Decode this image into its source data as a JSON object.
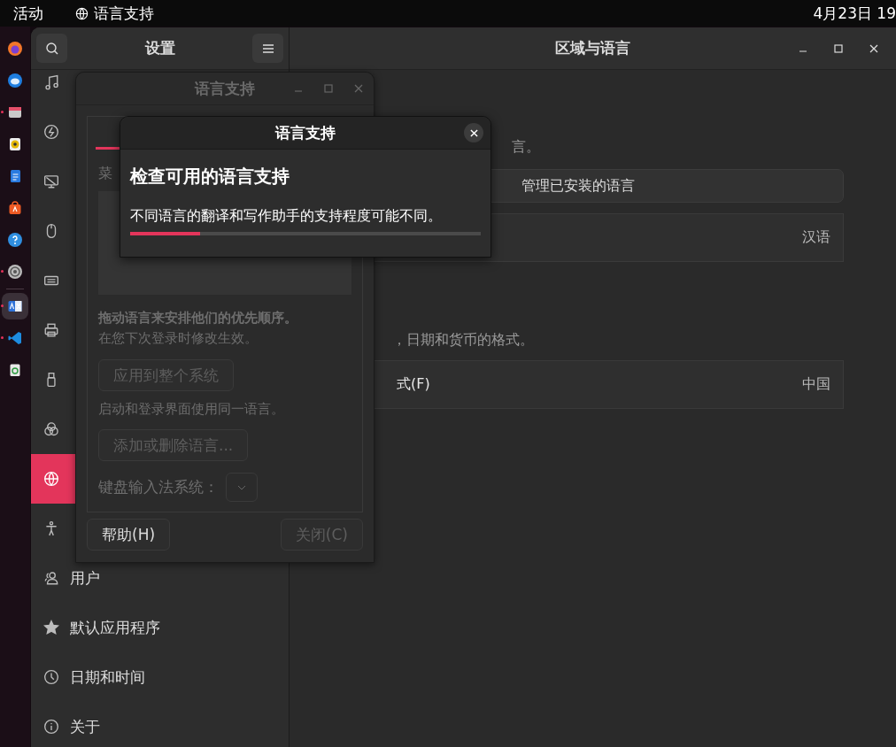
{
  "top_bar": {
    "activities": "活动",
    "app_menu": "语言支持",
    "clock": "4月23日 19"
  },
  "dock": [
    {
      "running": false,
      "selected": false
    },
    {
      "running": false,
      "selected": false
    },
    {
      "running": true,
      "selected": false
    },
    {
      "running": false,
      "selected": false
    },
    {
      "running": false,
      "selected": false
    },
    {
      "running": false,
      "selected": false
    },
    {
      "running": false,
      "selected": false
    },
    {
      "running": true,
      "selected": false
    },
    {
      "running": true,
      "selected": true
    },
    {
      "running": true,
      "selected": false
    },
    {
      "running": false,
      "selected": false
    }
  ],
  "settings_window": {
    "sidebar_title": "设置",
    "title": "区域与语言",
    "sidebar": [
      {
        "selected": false
      },
      {
        "selected": false
      },
      {
        "selected": false
      },
      {
        "selected": false
      },
      {
        "selected": false
      },
      {
        "selected": false
      },
      {
        "selected": false
      },
      {
        "selected": false
      },
      {
        "selected": true
      },
      {
        "selected": false
      },
      {
        "label": "用户",
        "selected": false
      },
      {
        "label": "默认应用程序",
        "selected": false
      },
      {
        "label": "日期和时间",
        "selected": false
      },
      {
        "label": "关于",
        "selected": false
      }
    ],
    "content": {
      "language_note": "言。",
      "manage_button": "管理已安装的语言",
      "language_value": "汉语",
      "formats_note": "，日期和货币的格式。",
      "formats_label": "式(F)",
      "formats_value": "中国"
    }
  },
  "language_window": {
    "title": "语言支持",
    "tabs": [
      {
        "selected": true
      }
    ],
    "list_label": "菜",
    "order_hint": "拖动语言来安排他们的优先顺序。",
    "login_hint": "在您下次登录时修改生效。",
    "apply_button": {
      "label": "应用到整个系统",
      "disabled": true
    },
    "system_hint": "启动和登录界面使用同一语言。",
    "add_button": {
      "label": "添加或删除语言...",
      "disabled": true
    },
    "input_label": "键盘输入法系统：",
    "help_button": {
      "label": "帮助(H)",
      "disabled": false
    },
    "close_button": {
      "label": "关闭(C)",
      "disabled": true
    }
  },
  "dialog": {
    "title": "语言支持",
    "heading": "检查可用的语言支持",
    "message": "不同语言的翻译和写作助手的支持程度可能不同。",
    "level": 0.2
  }
}
